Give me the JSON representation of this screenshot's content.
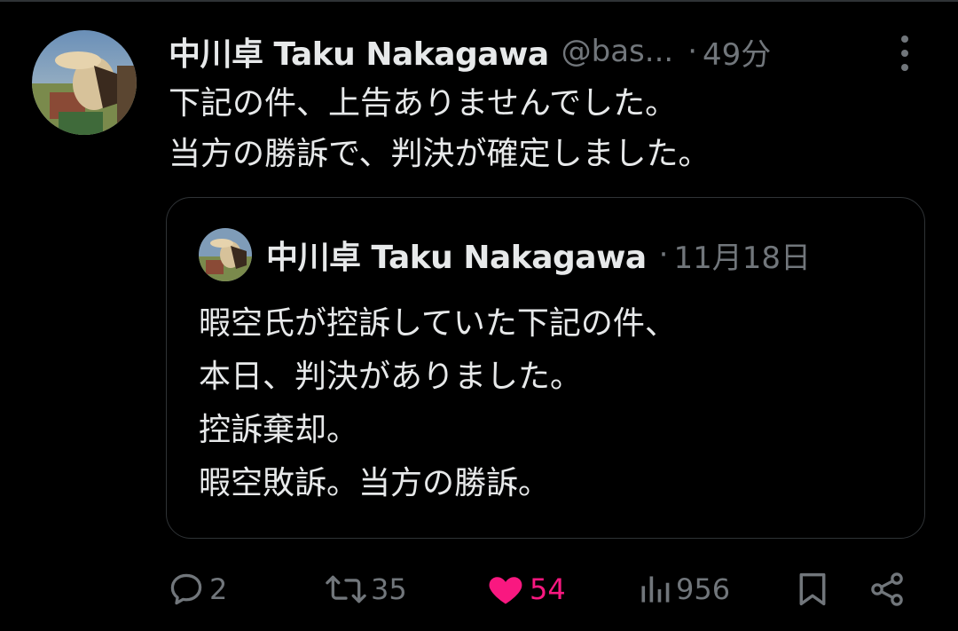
{
  "tweet": {
    "display_name": "中川卓 Taku Nakagawa",
    "handle": "@bas...",
    "separator": "·",
    "time": "49分",
    "text_lines": [
      "下記の件、上告ありませんでした。",
      "当方の勝訴で、判決が確定しました。"
    ]
  },
  "quote": {
    "display_name": "中川卓 Taku Nakagawa",
    "separator": "·",
    "date": "11月18日",
    "text_lines": [
      "暇空氏が控訴していた下記の件、",
      "本日、判決がありました。",
      "控訴棄却。",
      "暇空敗訴。当方の勝訴。"
    ]
  },
  "actions": {
    "replies": "2",
    "retweets": "35",
    "likes": "54",
    "views": "956"
  },
  "colors": {
    "background": "#000000",
    "text": "#e7e9ea",
    "muted": "#71767b",
    "border": "#2f3336",
    "like": "#f91880"
  },
  "icons": {
    "reply": "reply-icon",
    "retweet": "retweet-icon",
    "like": "heart-icon",
    "views": "views-icon",
    "bookmark": "bookmark-icon",
    "share": "share-icon",
    "more": "more-icon"
  }
}
